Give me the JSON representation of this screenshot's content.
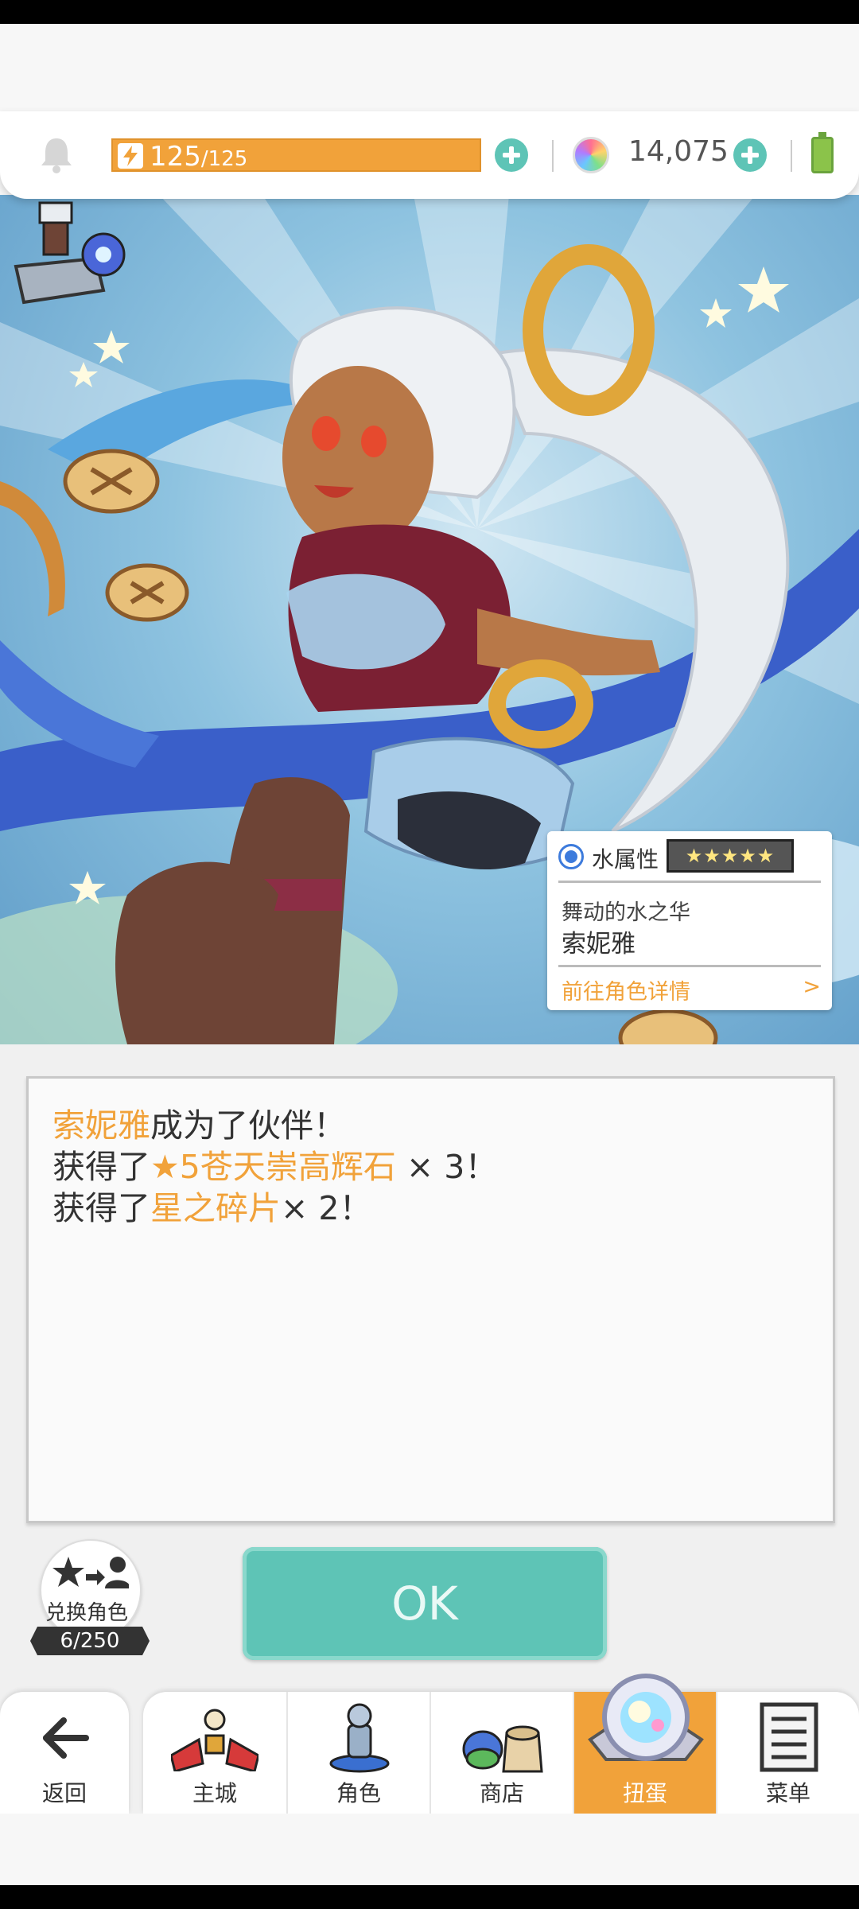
{
  "topbar": {
    "stamina_current": "125",
    "stamina_max": "/125",
    "gems": "14,075",
    "accent": "#f1a23a",
    "plus_color": "#5ec4b6"
  },
  "character": {
    "attribute": "水属性",
    "stars": "★★★★★",
    "title": "舞动的水之华",
    "name": "索妮雅",
    "detail_link": "前往角色详情",
    "detail_chevron": ">"
  },
  "message": {
    "line1_hl": "索妮雅",
    "line1_rest": "成为了伙伴！",
    "line2_pre": "获得了",
    "line2_hl": "★5苍天崇高辉石",
    "line2_post": " × 3！",
    "line3_pre": "获得了",
    "line3_hl": "星之碎片",
    "line3_post": "× 2！"
  },
  "exchange": {
    "label": "兑换角色",
    "count": "6/250"
  },
  "ok_label": "OK",
  "nav": {
    "back": "返回",
    "items": [
      {
        "label": "主城",
        "icon": "castle-icon"
      },
      {
        "label": "角色",
        "icon": "character-icon"
      },
      {
        "label": "商店",
        "icon": "shop-icon"
      },
      {
        "label": "扭蛋",
        "icon": "gacha-icon",
        "active": true
      },
      {
        "label": "菜单",
        "icon": "menu-icon"
      }
    ]
  }
}
